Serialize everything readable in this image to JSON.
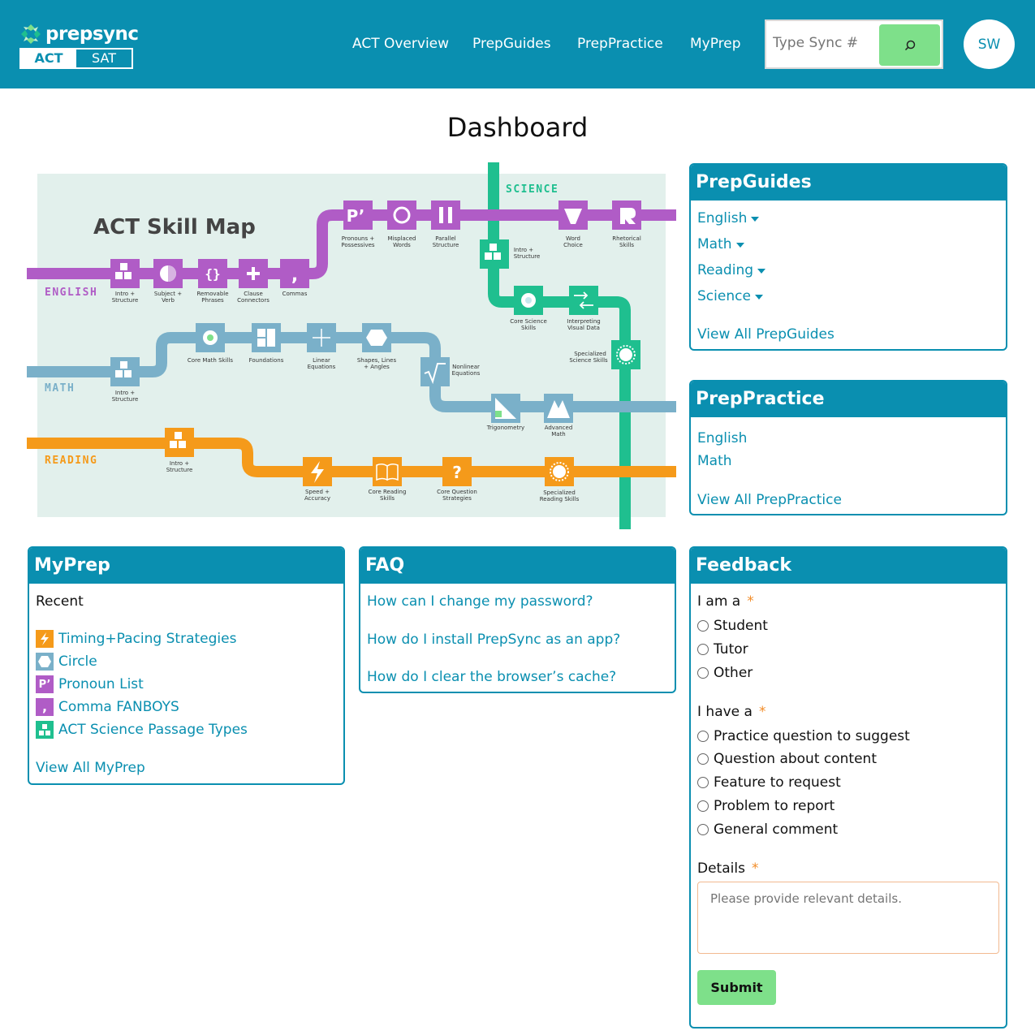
{
  "header": {
    "logo_text": "prepsync",
    "exam_tabs": [
      "ACT",
      "SAT"
    ],
    "nav": [
      "ACT Overview",
      "PrepGuides",
      "PrepPractice",
      "MyPrep"
    ],
    "search_placeholder": "Type Sync #",
    "avatar_initials": "SW",
    "brand_color": "#0a8fb0",
    "accent_green": "#7ee08a"
  },
  "page_title": "Dashboard",
  "skill_map": {
    "title": "ACT Skill Map",
    "tracks": {
      "english": "ENGLISH",
      "math": "MATH",
      "reading": "READING",
      "science": "SCIENCE"
    },
    "colors": {
      "english": "#b05cc6",
      "math": "#7ab0c9",
      "reading": "#f59a1a",
      "science": "#1fbf8f",
      "background": "#e2f0ec"
    },
    "english_nodes": [
      [
        "Intro +",
        "Structure"
      ],
      [
        "Subject +",
        "Verb"
      ],
      [
        "Removable",
        "Phrases"
      ],
      [
        "Clause",
        "Connectors"
      ],
      [
        "Commas",
        ""
      ],
      [
        "Pronouns +",
        "Possessives"
      ],
      [
        "Misplaced",
        "Words"
      ],
      [
        "Parallel",
        "Structure"
      ],
      [
        "Word",
        "Choice"
      ],
      [
        "Rhetorical",
        "Skills"
      ]
    ],
    "math_nodes": [
      [
        "Intro +",
        "Structure"
      ],
      [
        "Core Math Skills",
        ""
      ],
      [
        "Foundations",
        ""
      ],
      [
        "Linear",
        "Equations"
      ],
      [
        "Shapes, Lines",
        "+ Angles"
      ],
      [
        "Nonlinear",
        "Equations"
      ],
      [
        "Trigonometry",
        ""
      ],
      [
        "Advanced",
        "Math"
      ]
    ],
    "reading_nodes": [
      [
        "Intro +",
        "Structure"
      ],
      [
        "Speed +",
        "Accuracy"
      ],
      [
        "Core Reading",
        "Skills"
      ],
      [
        "Core Question",
        "Strategies"
      ],
      [
        "Specialized",
        "Reading Skills"
      ]
    ],
    "science_nodes": [
      [
        "Intro +",
        "Structure"
      ],
      [
        "Core Science",
        "Skills"
      ],
      [
        "Interpreting",
        "Visual Data"
      ],
      [
        "Specialized",
        "Science Skills"
      ]
    ]
  },
  "prepguides": {
    "title": "PrepGuides",
    "items": [
      "English",
      "Math",
      "Reading",
      "Science"
    ],
    "view_all": "View All PrepGuides"
  },
  "preppractice": {
    "title": "PrepPractice",
    "items": [
      "English",
      "Math"
    ],
    "view_all": "View All PrepPractice"
  },
  "myprep": {
    "title": "MyPrep",
    "recent_label": "Recent",
    "recent": [
      {
        "label": "Timing+Pacing Strategies",
        "icon": "lightning-icon",
        "color": "#f59a1a"
      },
      {
        "label": "Circle",
        "icon": "hexagon-icon",
        "color": "#7ab0c9"
      },
      {
        "label": "Pronoun List",
        "icon": "pronoun-icon",
        "color": "#b05cc6"
      },
      {
        "label": "Comma FANBOYS",
        "icon": "comma-icon",
        "color": "#b05cc6"
      },
      {
        "label": "ACT Science Passage Types",
        "icon": "blocks-icon",
        "color": "#1fbf8f"
      }
    ],
    "view_all": "View All MyPrep"
  },
  "faq": {
    "title": "FAQ",
    "items": [
      "How can I change my password?",
      "How do I install PrepSync as an app?",
      "How do I clear the browser’s cache?"
    ]
  },
  "feedback": {
    "title": "Feedback",
    "role_label": "I am a",
    "roles": [
      "Student",
      "Tutor",
      "Other"
    ],
    "type_label": "I have a",
    "types": [
      "Practice question to suggest",
      "Question about content",
      "Feature to request",
      "Problem to report",
      "General comment"
    ],
    "details_label": "Details",
    "details_placeholder": "Please provide relevant details.",
    "required_mark": "*",
    "submit_label": "Submit"
  }
}
